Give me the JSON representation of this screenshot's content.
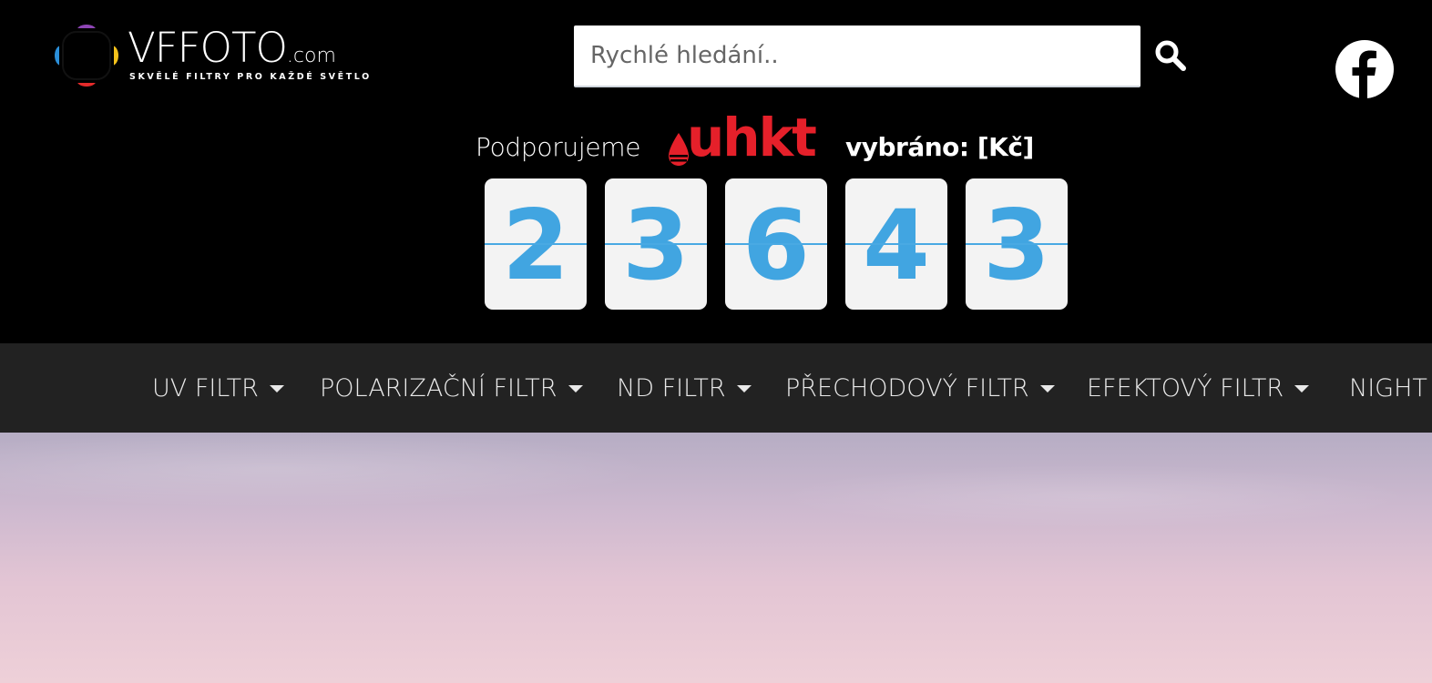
{
  "header": {
    "logo": {
      "word": "VFFOTO",
      "dotcom": ".com",
      "tagline": "SKVĚLÉ FILTRY PRO KAŽDÉ SVĚTLO"
    },
    "search": {
      "placeholder": "Rychlé hledání..",
      "value": "",
      "icon": "search-icon"
    },
    "social": {
      "icon": "facebook-icon"
    }
  },
  "support": {
    "label": "Podporujeme",
    "partner_logo": "uhkt",
    "collected_label": "vybráno: [Kč]",
    "counter_digits": [
      "2",
      "3",
      "6",
      "4",
      "3"
    ],
    "counter_value": 23643,
    "accent_color": "#41a5e1",
    "partner_color": "#e5202a"
  },
  "nav": {
    "items": [
      {
        "label": "UV FILTR"
      },
      {
        "label": "POLARIZAČNÍ FILTR"
      },
      {
        "label": "ND FILTR"
      },
      {
        "label": "PŘECHODOVÝ FILTR"
      },
      {
        "label": "EFEKTOVÝ FILTR"
      },
      {
        "label": "NIGHT"
      }
    ],
    "background": "#222222"
  }
}
